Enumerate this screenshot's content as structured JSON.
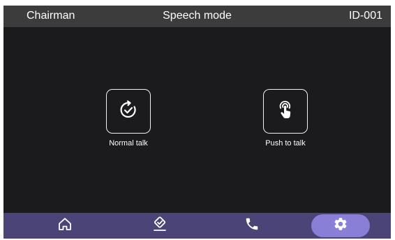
{
  "header": {
    "role": "Chairman",
    "title": "Speech mode",
    "device_id": "ID-001"
  },
  "modes": {
    "normal_talk": {
      "label": "Normal talk",
      "icon": "rotate-check-icon"
    },
    "push_to_talk": {
      "label": "Push to talk",
      "icon": "hand-tap-icon"
    }
  },
  "navbar": {
    "items": [
      {
        "icon": "home-icon",
        "active": false
      },
      {
        "icon": "edit-check-icon",
        "active": false
      },
      {
        "icon": "phone-icon",
        "active": false
      },
      {
        "icon": "gear-icon",
        "active": true
      }
    ]
  },
  "colors": {
    "background": "#1b1b1d",
    "header": "#3c3c3c",
    "navbar": "#4a4576",
    "active_pill": "#8a7fd6",
    "foreground": "#ffffff"
  }
}
